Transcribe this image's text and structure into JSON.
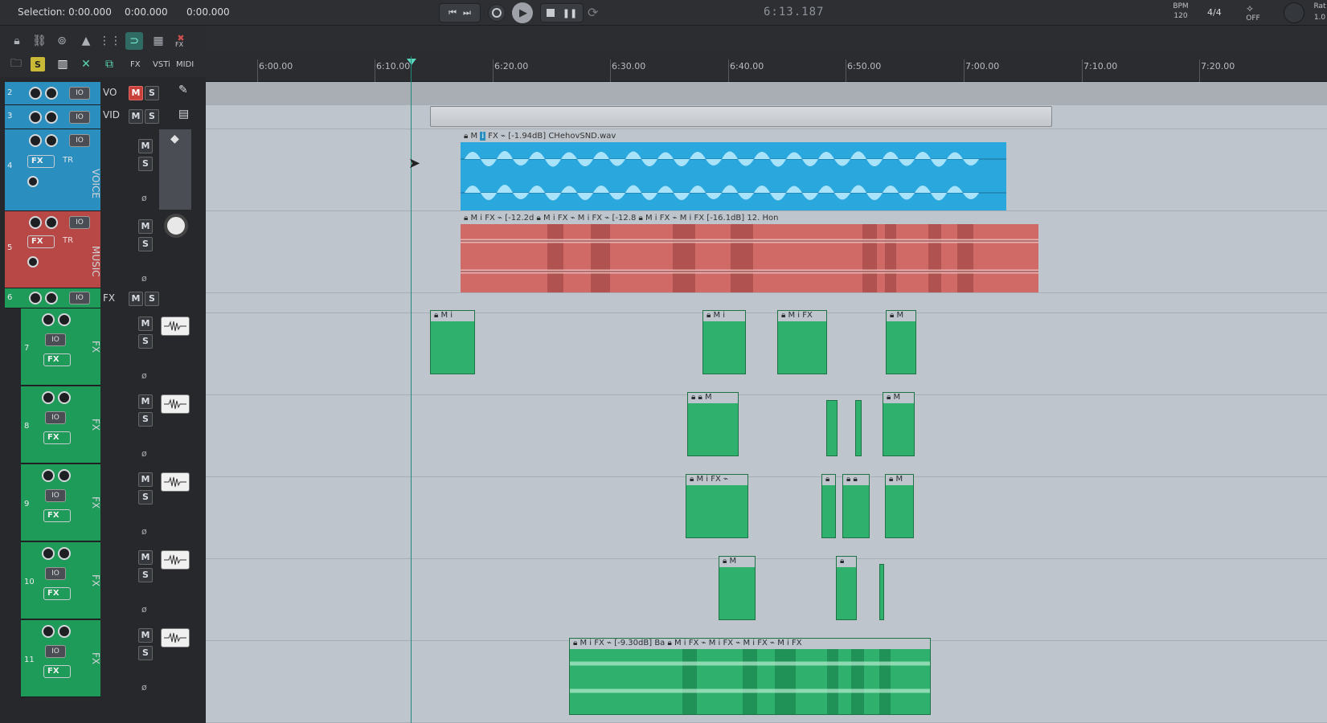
{
  "topbar": {
    "selection_label": "Selection: 0:00.000",
    "selection_end": "0:00.000",
    "selection_len": "0:00.000",
    "timecode": "6:13.187",
    "bpm_label": "BPM",
    "bpm_value": "120",
    "time_sig": "4/4",
    "off_label": "OFF",
    "rate_label": "Rat",
    "rate_value": "1.0"
  },
  "toolbar": {
    "fx_label": "FX",
    "vsti_label": "VSTi",
    "midi_label": "MIDI",
    "s_label": "S"
  },
  "ruler": {
    "ticks": [
      "6:00.00",
      "6:10.00",
      "6:20.00",
      "6:30.00",
      "6:40.00",
      "6:50.00",
      "7:00.00",
      "7:10.00",
      "7:20.00"
    ]
  },
  "tracks": [
    {
      "num": "2",
      "name": "VO",
      "io": "IO",
      "m": "M",
      "s": "S",
      "color": "#2a8fbf"
    },
    {
      "num": "3",
      "name": "VID",
      "io": "IO",
      "m": "M",
      "s": "S",
      "color": "#2a8fbf"
    },
    {
      "num": "4",
      "name": "VOICE",
      "io": "IO",
      "m": "M",
      "s": "S",
      "fx": "FX",
      "tr": "TR",
      "phase": "ø",
      "color": "#2a8fbf"
    },
    {
      "num": "5",
      "name": "MUSIC",
      "io": "IO",
      "m": "M",
      "s": "S",
      "fx": "FX",
      "tr": "TR",
      "phase": "ø",
      "color": "#b74846"
    },
    {
      "num": "6",
      "name": "FX",
      "io": "IO",
      "m": "M",
      "s": "S",
      "color": "#1e9a59"
    },
    {
      "num": "7",
      "name": "FX",
      "io": "IO",
      "m": "M",
      "s": "S",
      "fx": "FX",
      "phase": "ø",
      "color": "#1e9a59"
    },
    {
      "num": "8",
      "name": "FX",
      "io": "IO",
      "m": "M",
      "s": "S",
      "fx": "FX",
      "phase": "ø",
      "color": "#1e9a59"
    },
    {
      "num": "9",
      "name": "FX",
      "io": "IO",
      "m": "M",
      "s": "S",
      "fx": "FX",
      "phase": "ø",
      "color": "#1e9a59"
    },
    {
      "num": "10",
      "name": "FX",
      "io": "IO",
      "m": "M",
      "s": "S",
      "fx": "FX",
      "phase": "ø",
      "color": "#1e9a59"
    },
    {
      "num": "11",
      "name": "FX",
      "io": "IO",
      "m": "M",
      "s": "S",
      "fx": "FX",
      "phase": "ø",
      "color": "#1e9a59"
    }
  ],
  "clips": {
    "voice_clip": "[-1.94dB] CHehovSND.wav",
    "music_a": "[-12.2d",
    "music_b": "[-12.8",
    "music_c": "[-16.1dB] 12. Hon",
    "fx11_clip": "[-9.30dB] Ba"
  }
}
